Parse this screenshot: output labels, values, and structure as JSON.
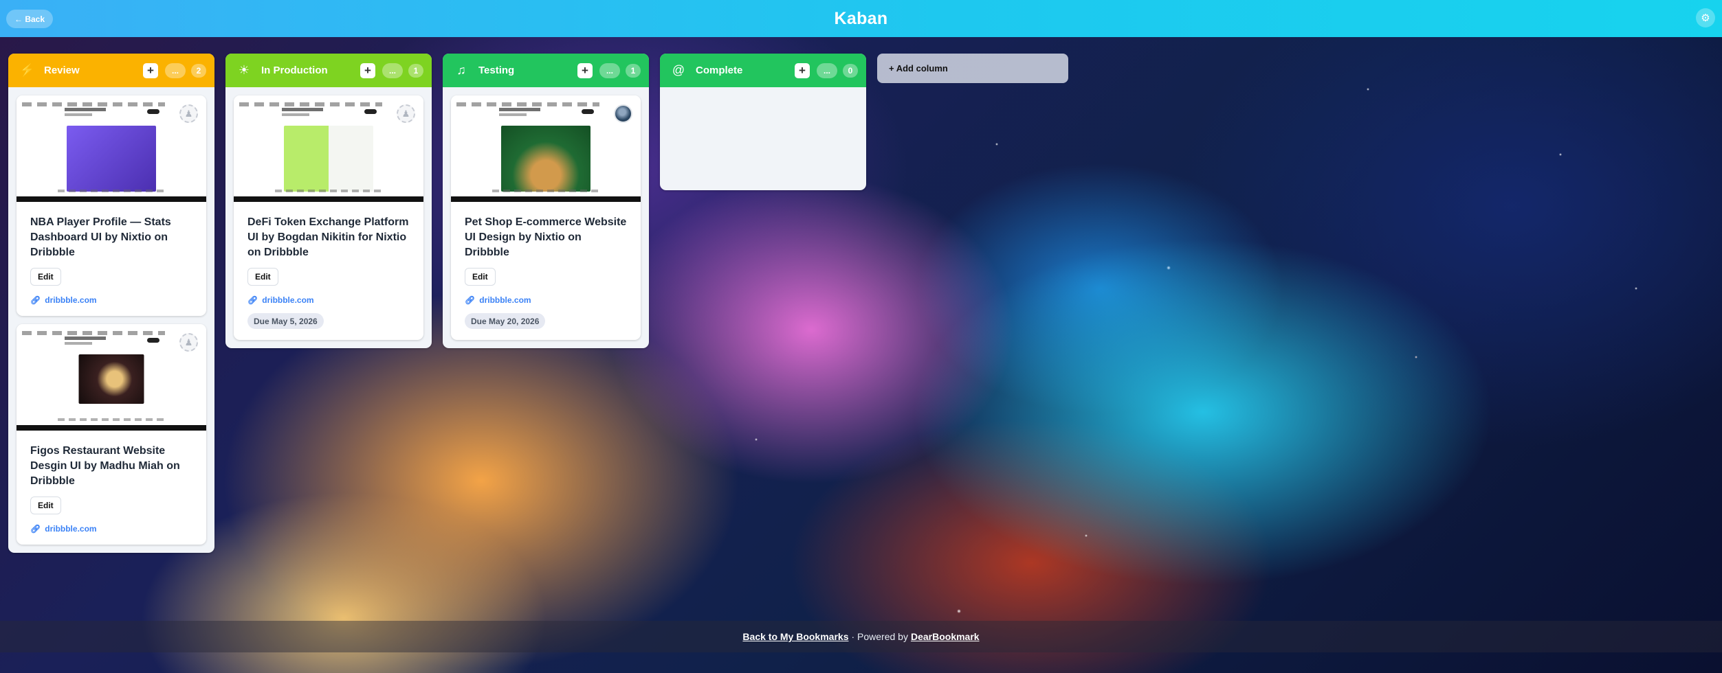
{
  "header": {
    "back_label": "← Back",
    "title": "Kaban",
    "settings_icon": "gear-icon"
  },
  "columns": [
    {
      "title": "Review",
      "icon": "⚡",
      "color": "#fbb200",
      "add_label": "+",
      "more_label": "...",
      "count": "2",
      "cards": [
        {
          "title": "NBA Player Profile — Stats Dashboard UI by Nixtio on Dribbble",
          "edit_label": "Edit",
          "link": "dribbble.com",
          "hero_color": "#6b4dd6"
        },
        {
          "title": "Figos Restaurant Website Desgin UI by Madhu Miah on Dribbble",
          "edit_label": "Edit",
          "link": "dribbble.com",
          "hero_color": "#2a1b1b"
        }
      ]
    },
    {
      "title": "In Production",
      "icon": "☀",
      "color": "#7ed321",
      "add_label": "+",
      "more_label": "...",
      "count": "1",
      "cards": [
        {
          "title": "DeFi Token Exchange Platform UI by Bogdan Nikitin for Nixtio on Dribbble",
          "edit_label": "Edit",
          "link": "dribbble.com",
          "due": "Due May 5, 2026",
          "hero_color": "#a4e05a"
        }
      ]
    },
    {
      "title": "Testing",
      "icon": "♫",
      "color": "#22c55e",
      "add_label": "+",
      "more_label": "...",
      "count": "1",
      "cards": [
        {
          "title": "Pet Shop E-commerce Website UI Design by Nixtio on Dribbble",
          "edit_label": "Edit",
          "link": "dribbble.com",
          "due": "Due May 20, 2026",
          "hero_color": "#1f6b33"
        }
      ]
    },
    {
      "title": "Complete",
      "icon": "@",
      "color": "#22c55e",
      "add_label": "+",
      "more_label": "...",
      "count": "0",
      "cards": []
    }
  ],
  "add_column_label": "+ Add column",
  "footer": {
    "back_link": "Back to My Bookmarks",
    "powered_text": "· Powered by",
    "brand_link": "DearBookmark"
  }
}
